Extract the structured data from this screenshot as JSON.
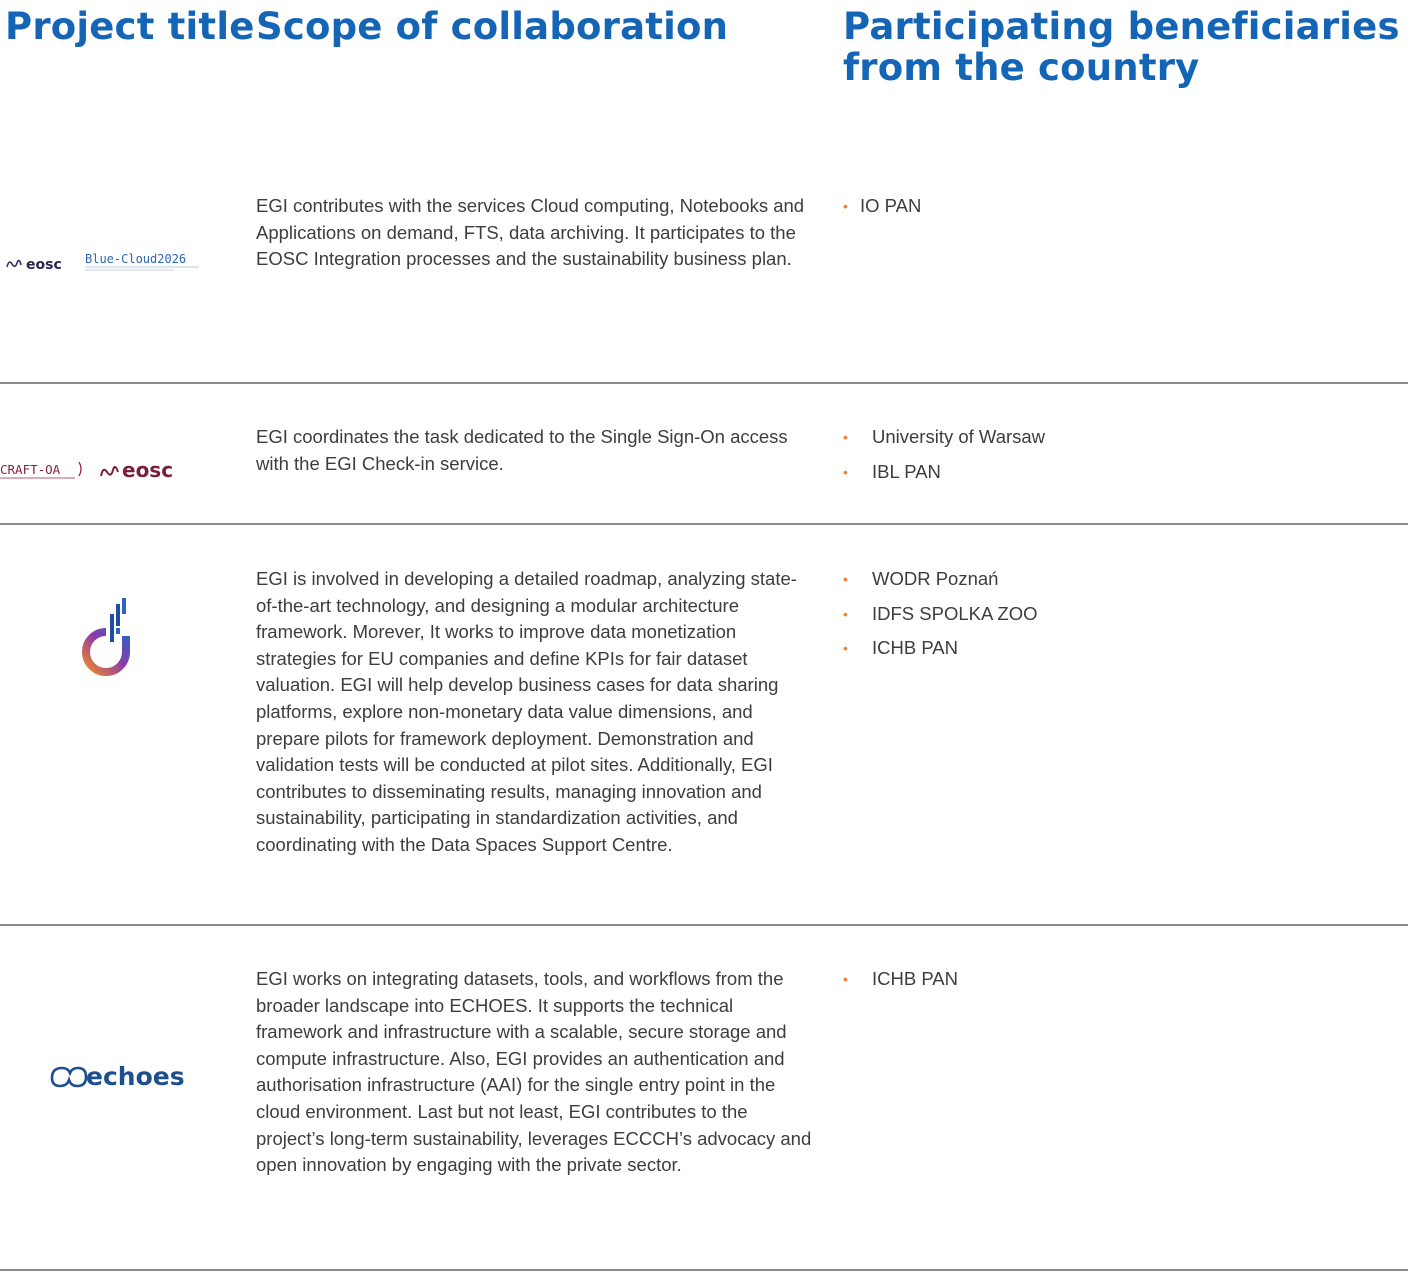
{
  "headers": {
    "title": "Project title",
    "scope": "Scope of collaboration",
    "benef_line1": "Participating beneficiaries",
    "benef_line2": "from the country"
  },
  "rows": [
    {
      "logo_text_a": "eosc",
      "logo_text_b": "Blue-Cloud2026",
      "scope": "EGI contributes with the services Cloud computing, Notebooks and Applications on demand, FTS, data archiving. It participates to the EOSC Integration processes and the sustainability business plan.",
      "beneficiaries": [
        "IO PAN"
      ]
    },
    {
      "logo_text_a": "CRAFT-OA",
      "logo_text_b": "eosc",
      "scope": "EGI coordinates the task dedicated to the Single Sign-On access with the EGI Check-in service.",
      "beneficiaries": [
        "University of Warsaw",
        "IBL PAN"
      ]
    },
    {
      "scope": "EGI is involved in developing a detailed roadmap, analyzing state-of-the-art technology, and designing a modular architecture framework. Morever, It works to improve data monetization strategies for EU companies and define KPIs for fair dataset valuation. EGI will help develop business cases for data sharing platforms, explore non-monetary data value dimensions, and prepare pilots for framework deployment. Demonstration and validation tests will be conducted at pilot sites. Additionally, EGI contributes to disseminating results, managing innovation and sustainability, participating in standardization activities, and coordinating with the Data Spaces Support Centre.",
      "beneficiaries": [
        "WODR Poznań",
        "IDFS SPOLKA ZOO",
        "ICHB PAN"
      ]
    },
    {
      "logo_text_a": "echoes",
      "scope": "EGI works on integrating datasets, tools, and workflows from the broader landscape into ECHOES. It supports the technical framework and infrastructure with a scalable, secure storage and compute infrastructure. Also, EGI provides an authentication and authorisation infrastructure (AAI) for the single entry point in the cloud environment. Last but not least, EGI contributes to the project’s long-term sustainability, leverages ECCCH’s advocacy and open innovation by engaging with the private sector.",
      "beneficiaries": [
        "ICHB PAN"
      ]
    }
  ],
  "colors": {
    "heading": "#1565b6",
    "bullet": "#e8833a",
    "separator": "#8a8a8a",
    "text": "#3d3d3d"
  }
}
